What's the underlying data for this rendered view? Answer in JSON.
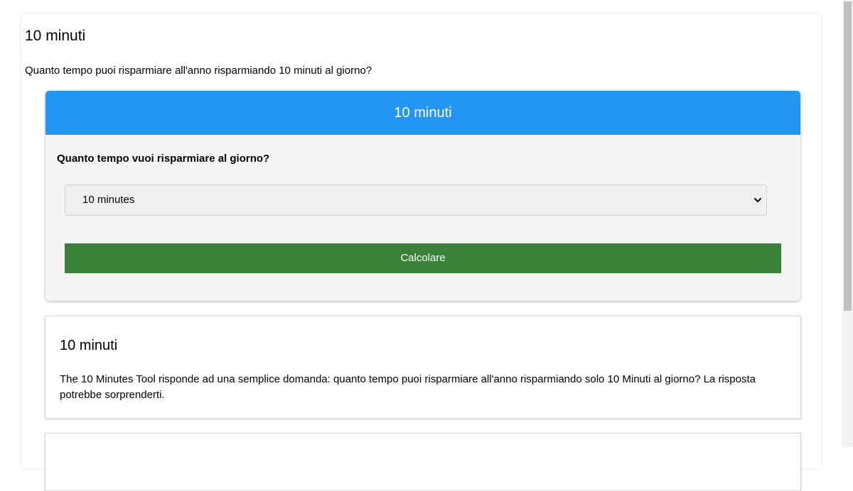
{
  "page": {
    "title": "10 minuti",
    "intro": "Quanto tempo puoi risparmiare all'anno risparmiando 10 minuti al giorno?"
  },
  "calculator": {
    "header": "10 minuti",
    "question": "Quanto tempo vuoi risparmiare al giorno?",
    "selected_option": "10 minutes",
    "button_label": "Calcolare",
    "colors": {
      "header": "#2196f3",
      "button": "#3b8139"
    }
  },
  "info": {
    "title": "10 minuti",
    "text": "The 10 Minutes Tool risponde ad una semplice domanda: quanto tempo puoi risparmiare all'anno risparmiando solo 10 Minuti al giorno? La risposta potrebbe sorprenderti."
  },
  "icons": {
    "select_arrow": "chevron-down-icon"
  }
}
